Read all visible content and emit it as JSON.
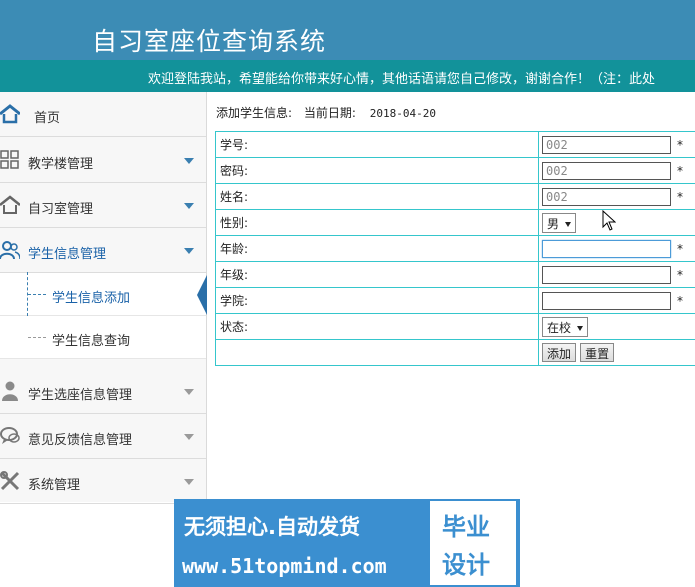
{
  "header": {
    "title": "自习室座位查询系统"
  },
  "notice": "欢迎登陆我站，希望能给你带来好心情，其他话语请您自己修改，谢谢合作！（注：此处",
  "sidebar": {
    "home": "首页",
    "items": [
      {
        "label": "教学楼管理"
      },
      {
        "label": "自习室管理"
      },
      {
        "label": "学生信息管理"
      },
      {
        "label": "学生选座信息管理"
      },
      {
        "label": "意见反馈信息管理"
      },
      {
        "label": "系统管理"
      }
    ],
    "sub_items": [
      {
        "label": "学生信息添加"
      },
      {
        "label": "学生信息查询"
      }
    ]
  },
  "main": {
    "heading": "添加学生信息:",
    "date_label": "当前日期:",
    "date": "2018-04-20"
  },
  "form": {
    "required_mark": "*",
    "fields": {
      "student_id": {
        "label": "学号:",
        "value": "002"
      },
      "password": {
        "label": "密码:",
        "value": "002"
      },
      "name": {
        "label": "姓名:",
        "value": "002"
      },
      "gender": {
        "label": "性别:",
        "value": "男"
      },
      "age": {
        "label": "年龄:",
        "value": ""
      },
      "grade": {
        "label": "年级:",
        "value": ""
      },
      "college": {
        "label": "学院:",
        "value": ""
      },
      "status": {
        "label": "状态:",
        "value": "在校"
      }
    },
    "add_button": "添加",
    "reset_button": "重置"
  },
  "banner": {
    "line1": "无须担心.自动发货",
    "line2": "www.51topmind.com",
    "box_line1": "毕业",
    "box_line2": "设计"
  },
  "colors": {
    "header": "#3c8cb5",
    "notice_bar": "#12929a",
    "table_border": "#35c6cc",
    "accent": "#1a62a8",
    "banner": "#3b8fd0"
  }
}
